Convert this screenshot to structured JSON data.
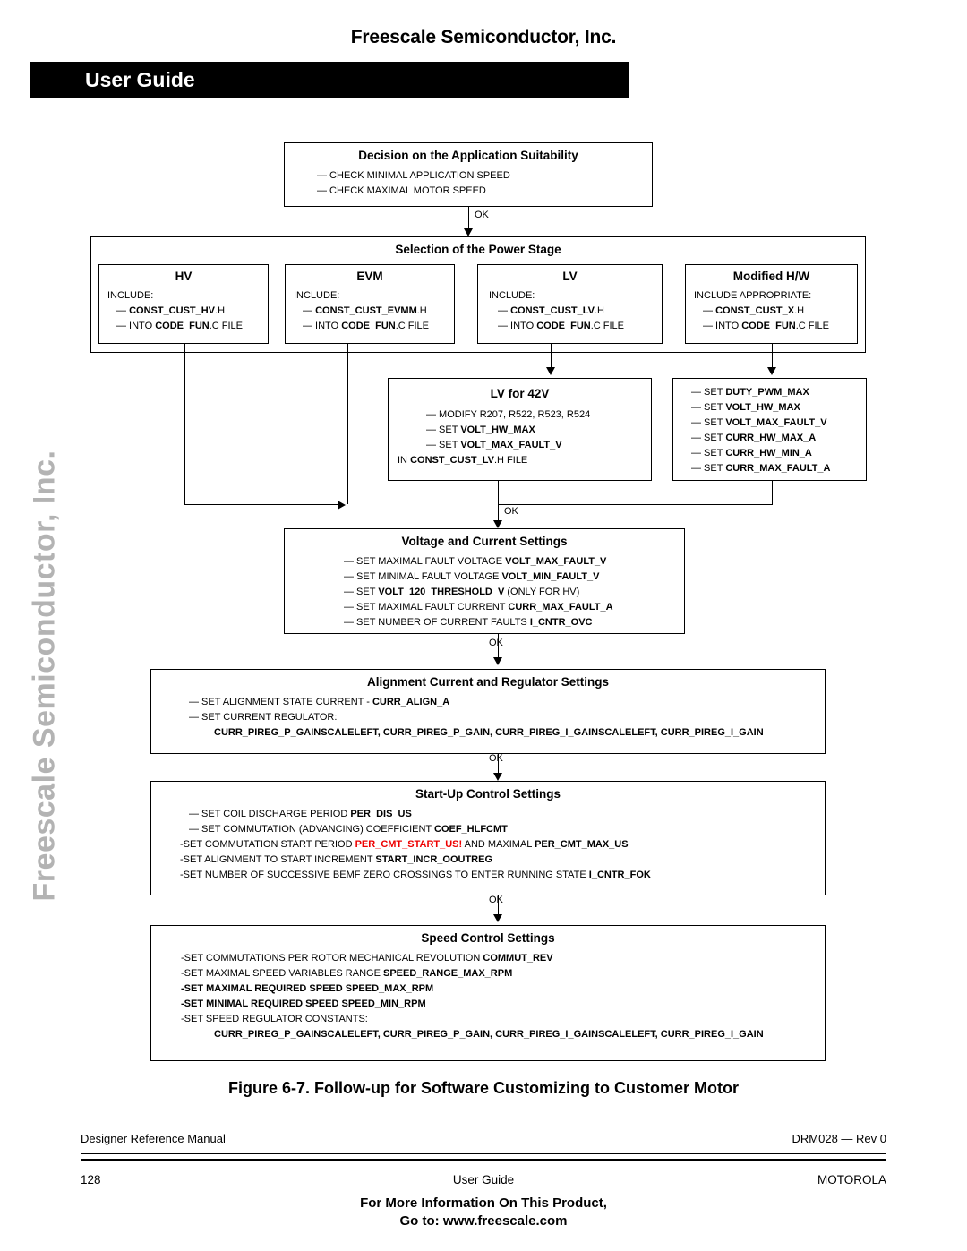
{
  "header": {
    "company_title": "Freescale Semiconductor, Inc.",
    "banner_label": "User Guide"
  },
  "watermark": "Freescale Semiconductor, Inc.",
  "flowchart": {
    "ok_label": "OK",
    "decision": {
      "title": "Decision on the Application Suitability",
      "lines": [
        "— CHECK MINIMAL APPLICATION SPEED",
        "— CHECK MAXIMAL MOTOR SPEED"
      ]
    },
    "power_stage": {
      "title": "Selection of the Power Stage",
      "options": [
        {
          "title": "HV",
          "lines": [
            "INCLUDE:",
            "— CONST_CUST_HV.H",
            "— INTO CODE_FUN.C FILE"
          ]
        },
        {
          "title": "EVM",
          "lines": [
            "INCLUDE:",
            "— CONST_CUST_EVMM.H",
            "— INTO CODE_FUN.C FILE"
          ]
        },
        {
          "title": "LV",
          "lines": [
            "INCLUDE:",
            "— CONST_CUST_LV.H",
            "— INTO CODE_FUN.C FILE"
          ]
        },
        {
          "title": "Modified H/W",
          "lines": [
            "INCLUDE APPROPRIATE:",
            "— CONST_CUST_X.H",
            "— INTO CODE_FUN.C FILE"
          ]
        }
      ]
    },
    "lv42": {
      "title": "LV for 42V",
      "lines": [
        "— MODIFY R207, R522, R523, R524",
        "— SET VOLT_HW_MAX",
        "— SET VOLT_MAX_FAULT_V",
        "IN CONST_CUST_LV.H FILE"
      ]
    },
    "modified_hw_settings": {
      "lines": [
        "— SET DUTY_PWM_MAX",
        "— SET VOLT_HW_MAX",
        "— SET VOLT_MAX_FAULT_V",
        "— SET CURR_HW_MAX_A",
        "— SET CURR_HW_MIN_A",
        "— SET CURR_MAX_FAULT_A"
      ]
    },
    "voltage_current": {
      "title": "Voltage and Current Settings",
      "lines": [
        "— SET MAXIMAL FAULT VOLTAGE VOLT_MAX_FAULT_V",
        "— SET MINIMAL FAULT VOLTAGE VOLT_MIN_FAULT_V",
        "— SET VOLT_120_THRESHOLD_V (ONLY FOR HV)",
        "— SET MAXIMAL FAULT CURRENT CURR_MAX_FAULT_A",
        "— SET NUMBER OF CURRENT FAULTS I_CNTR_OVC"
      ]
    },
    "alignment": {
      "title": "Alignment Current and Regulator Settings",
      "lines": [
        "— SET ALIGNMENT STATE CURRENT - CURR_ALIGN_A",
        "— SET CURRENT REGULATOR:",
        "CURR_PIREG_P_GAINSCALELEFT, CURR_PIREG_P_GAIN, CURR_PIREG_I_GAINSCALELEFT, CURR_PIREG_I_GAIN"
      ]
    },
    "startup": {
      "title": "Start-Up Control Settings",
      "lines": [
        "— SET COIL DISCHARGE PERIOD PER_DIS_US",
        "— SET COMMUTATION (ADVANCING) COEFFICIENT COEF_HLFCMT",
        "-SET COMMUTATION START PERIOD PER_CMT_START_US! AND MAXIMAL PER_CMT_MAX_US",
        "-SET ALIGNMENT TO START INCREMENT START_INCR_OOUTREG",
        "-SET NUMBER OF SUCCESSIVE BEMF ZERO CROSSINGS TO ENTER RUNNING STATE I_CNTR_FOK"
      ],
      "highlight_red": "PER_CMT_START_US!"
    },
    "speed": {
      "title": "Speed Control Settings",
      "lines": [
        "-SET COMMUTATIONS PER ROTOR MECHANICAL REVOLUTION COMMUT_REV",
        "-SET MAXIMAL SPEED VARIABLES RANGE SPEED_RANGE_MAX_RPM",
        "-SET MAXIMAL REQUIRED SPEED SPEED_MAX_RPM",
        "-SET MINIMAL REQUIRED SPEED SPEED_MIN_RPM",
        "-SET SPEED REGULATOR CONSTANTS:",
        "CURR_PIREG_P_GAINSCALELEFT, CURR_PIREG_P_GAIN, CURR_PIREG_I_GAINSCALELEFT, CURR_PIREG_I_GAIN"
      ]
    }
  },
  "caption": "Figure 6-7. Follow-up for Software Customizing to Customer Motor",
  "footer": {
    "manual_name": "Designer Reference Manual",
    "doc_rev": "DRM028 — Rev 0",
    "page_number": "128",
    "doc_type": "User Guide",
    "publisher": "MOTOROLA",
    "promo_line1": "For More Information On This Product,",
    "promo_line2": "Go to: www.freescale.com"
  },
  "colors": {
    "accent_red": "#ee0000",
    "watermark_gray": "#b3b3b3",
    "banner_black": "#000000"
  }
}
